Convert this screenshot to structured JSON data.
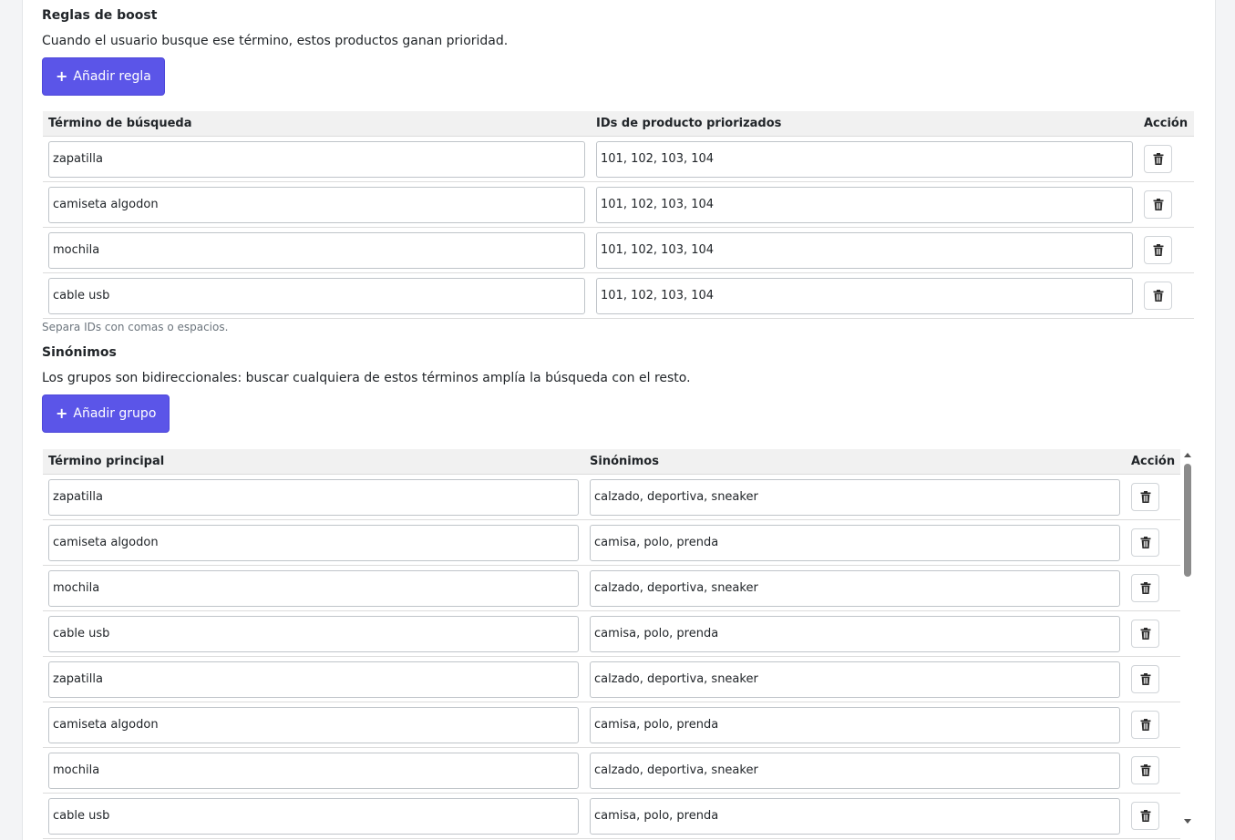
{
  "boost": {
    "title": "Reglas de boost",
    "description": "Cuando el usuario busque ese término, estos productos ganan prioridad.",
    "add_button": "Añadir regla",
    "columns": {
      "term": "Término de búsqueda",
      "ids": "IDs de producto priorizados",
      "action": "Acción"
    },
    "rows": [
      {
        "term": "zapatilla",
        "ids": "101, 102, 103, 104"
      },
      {
        "term": "camiseta algodon",
        "ids": "101, 102, 103, 104"
      },
      {
        "term": "mochila",
        "ids": "101, 102, 103, 104"
      },
      {
        "term": "cable usb",
        "ids": "101, 102, 103, 104"
      }
    ],
    "helper": "Separa IDs con comas o espacios."
  },
  "synonyms": {
    "title": "Sinónimos",
    "description": "Los grupos son bidireccionales: buscar cualquiera de estos términos amplía la búsqueda con el resto.",
    "add_button": "Añadir grupo",
    "columns": {
      "term": "Término principal",
      "synonyms": "Sinónimos",
      "action": "Acción"
    },
    "rows": [
      {
        "term": "zapatilla",
        "synonyms": "calzado, deportiva, sneaker"
      },
      {
        "term": "camiseta algodon",
        "synonyms": "camisa, polo, prenda"
      },
      {
        "term": "mochila",
        "synonyms": "calzado, deportiva, sneaker"
      },
      {
        "term": "cable usb",
        "synonyms": "camisa, polo, prenda"
      },
      {
        "term": "zapatilla",
        "synonyms": "calzado, deportiva, sneaker"
      },
      {
        "term": "camiseta algodon",
        "synonyms": "camisa, polo, prenda"
      },
      {
        "term": "mochila",
        "synonyms": "calzado, deportiva, sneaker"
      },
      {
        "term": "cable usb",
        "synonyms": "camisa, polo, prenda"
      }
    ]
  },
  "icons": {
    "add": "plus-icon",
    "delete": "trash-icon"
  },
  "colors": {
    "primary": "#5b55e8",
    "header_bg": "#f1f1f1",
    "helper_text": "#6c757d"
  }
}
